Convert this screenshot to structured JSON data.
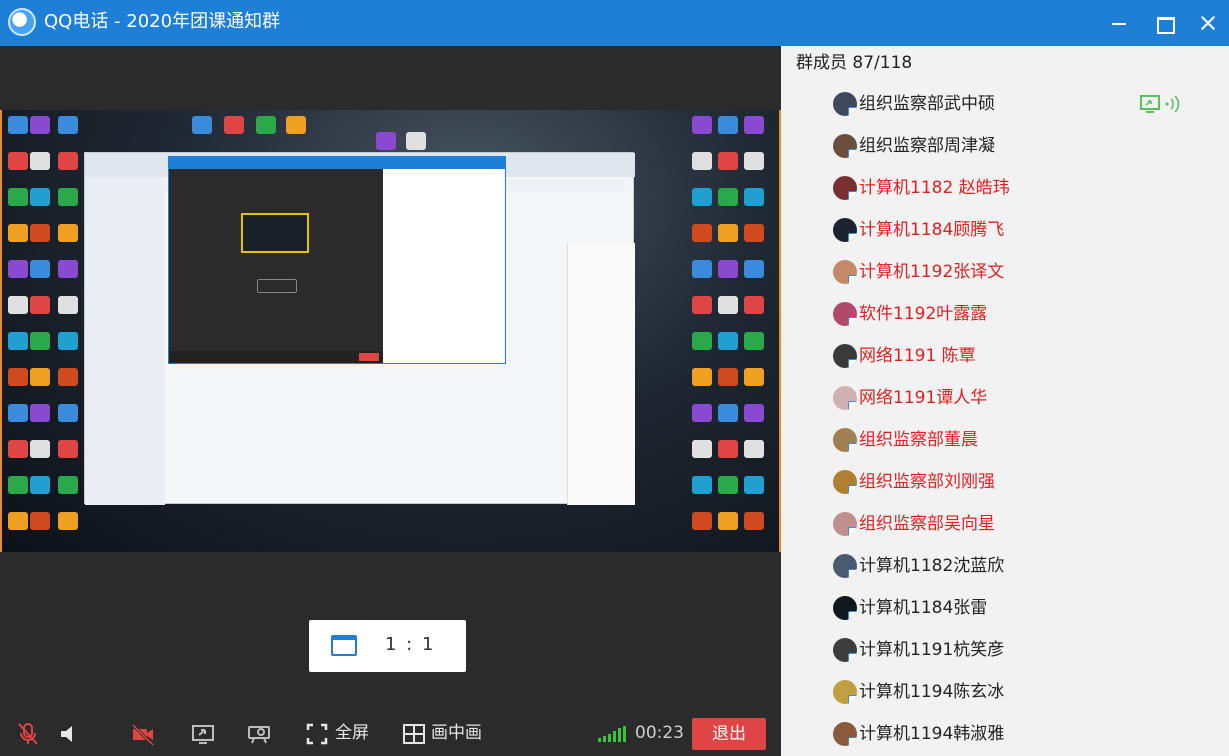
{
  "window": {
    "title": "QQ电话 - 2020年团课通知群"
  },
  "view": {
    "ratio_label": "1 : 1"
  },
  "toolbar": {
    "fullscreen_label": "全屏",
    "pip_label": "画中画",
    "timer": "00:23",
    "exit_label": "退出"
  },
  "members": {
    "header": "群成员 87/118",
    "list": [
      {
        "name": "组织监察部武中硕",
        "color": "#222222"
      },
      {
        "name": "组织监察部周津凝",
        "color": "#222222"
      },
      {
        "name": "计算机1182 赵皓玮",
        "color": "#e02020"
      },
      {
        "name": "计算机1184顾腾飞",
        "color": "#e02020"
      },
      {
        "name": "计算机1192张译文",
        "color": "#e02020"
      },
      {
        "name": "软件1192叶露露",
        "color": "#e02020"
      },
      {
        "name": "网络1191 陈覃",
        "color": "#e02020"
      },
      {
        "name": "网络1191谭人华",
        "color": "#e02020"
      },
      {
        "name": "组织监察部董晨",
        "color": "#e02020"
      },
      {
        "name": "组织监察部刘刚强",
        "color": "#e02020"
      },
      {
        "name": "组织监察部吴向星",
        "color": "#e02020"
      },
      {
        "name": "计算机1182沈蓝欣",
        "color": "#222222"
      },
      {
        "name": "计算机1184张雷",
        "color": "#222222"
      },
      {
        "name": "计算机1191杭笑彦",
        "color": "#222222"
      },
      {
        "name": "计算机1194陈玄冰",
        "color": "#222222"
      },
      {
        "name": "计算机1194韩淑雅",
        "color": "#222222"
      }
    ]
  },
  "colors": {
    "titlebar": "#1e7fd6",
    "exit": "#e04545",
    "share_border": "#f08a24",
    "signal": "#3cc23c"
  }
}
